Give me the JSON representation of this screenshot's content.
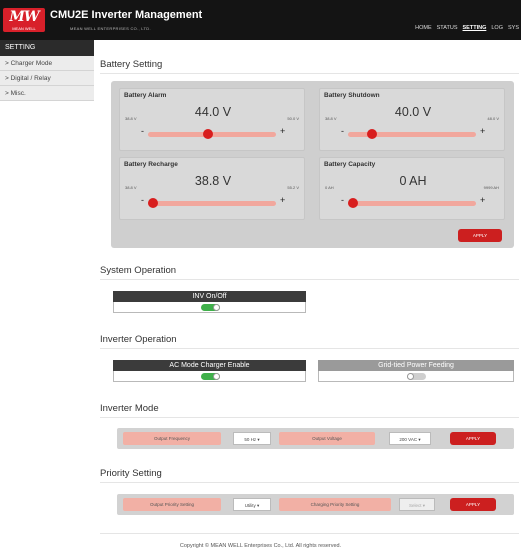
{
  "header": {
    "logo_text": "MW",
    "logo_sub": "MEAN WELL",
    "title": "CMU2E Inverter Management",
    "company": "MEAN WELL ENTERPRISES CO., LTD.",
    "nav": [
      "HOME",
      "STATUS",
      "SETTING",
      "LOG",
      "SYS"
    ],
    "active_nav": "SETTING"
  },
  "sidebar": {
    "title": "SETTING",
    "items": [
      "> Charger Mode",
      "> Digital / Relay",
      "> Misc."
    ]
  },
  "battery": {
    "title": "Battery Setting",
    "cards": [
      {
        "title": "Battery Alarm",
        "value": "44.0 V",
        "min": "38.8 V",
        "max": "50.0 V",
        "level": 0.47
      },
      {
        "title": "Battery Shutdown",
        "value": "40.0 V",
        "min": "38.8 V",
        "max": "48.0 V",
        "level": 0.16
      },
      {
        "title": "Battery Recharge",
        "value": "38.8 V",
        "min": "38.8 V",
        "max": "55.2 V",
        "level": 0.0
      },
      {
        "title": "Battery Capacity",
        "value": "0 AH",
        "min": "0 AH",
        "max": "9999 AH",
        "level": 0.0
      }
    ],
    "apply_label": "APPLY",
    "minus": "-",
    "plus": "+"
  },
  "system_operation": {
    "title": "System Operation",
    "toggle_label": "INV On/Off",
    "toggle_on": true
  },
  "inverter_operation": {
    "title": "Inverter Operation",
    "ac_label": "AC Mode Charger Enable",
    "ac_on": true,
    "grid_label": "Grid-tied Power Feeding",
    "grid_on": false
  },
  "inverter_mode": {
    "title": "Inverter Mode",
    "freq_label": "Output Frequency",
    "freq_value": "50 Hz",
    "volt_label": "Output Voltage",
    "volt_value": "200 VAC",
    "apply_label": "APPLY"
  },
  "priority": {
    "title": "Priority Setting",
    "output_label": "Output Priority Setting",
    "output_value": "Utility",
    "charging_label": "Charging Priority Setting",
    "charging_value": "Select",
    "apply_label": "APPLY"
  },
  "footer": "Copyright © MEAN WELL Enterprises Co., Ltd. All rights reserved.",
  "colors": {
    "accent_red": "#cc1f1f",
    "slider_track": "#f1a79d",
    "toggle_on": "#3fb04a",
    "toggle_off": "#cfcfcf",
    "header_bg": "#141414"
  }
}
